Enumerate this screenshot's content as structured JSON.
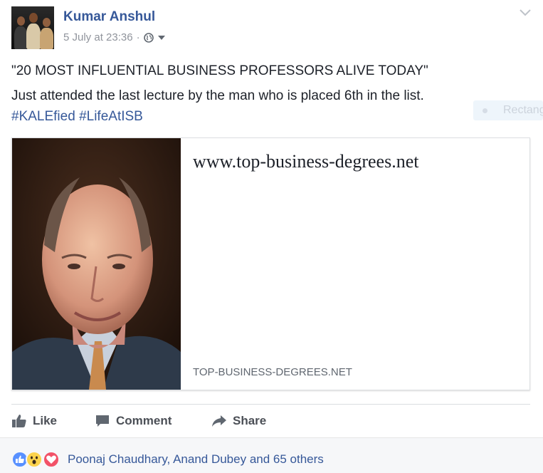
{
  "post": {
    "author": "Kumar Anshul",
    "timestamp": "5 July at 23:36",
    "separator": "·",
    "privacy_icon": "globe-icon",
    "text_line1": "\"20 MOST INFLUENTIAL BUSINESS PROFESSORS ALIVE TODAY\"",
    "text_line2": "Just attended the last lecture by the man who is placed 6th in the list.",
    "hashtags": [
      "#KALEfied",
      "#LifeAtISB"
    ],
    "overlay_label": "Rectang"
  },
  "link_card": {
    "title": "www.top-business-degrees.net",
    "domain": "TOP-BUSINESS-DEGREES.NET"
  },
  "actions": {
    "like": "Like",
    "comment": "Comment",
    "share": "Share"
  },
  "reactions": {
    "types": [
      "like",
      "wow",
      "love"
    ],
    "summary": "Poonaj Chaudhary, Anand Dubey and 65 others"
  },
  "colors": {
    "link_blue": "#365899",
    "meta_gray": "#90949c",
    "like_blue": "#5890ff",
    "love_red": "#f25268",
    "wow_yellow": "#fcd34d"
  }
}
